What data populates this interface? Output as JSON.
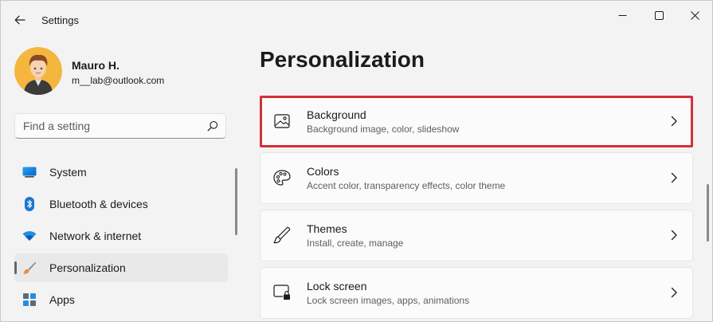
{
  "window": {
    "title": "Settings"
  },
  "profile": {
    "name": "Mauro H.",
    "email": "m__lab@outlook.com"
  },
  "search": {
    "placeholder": "Find a setting"
  },
  "sidebar": {
    "items": [
      {
        "label": "System",
        "icon": "system-icon",
        "selected": false
      },
      {
        "label": "Bluetooth & devices",
        "icon": "bluetooth-icon",
        "selected": false
      },
      {
        "label": "Network & internet",
        "icon": "wifi-icon",
        "selected": false
      },
      {
        "label": "Personalization",
        "icon": "brush-icon",
        "selected": true
      },
      {
        "label": "Apps",
        "icon": "apps-icon",
        "selected": false
      }
    ]
  },
  "main": {
    "title": "Personalization",
    "cards": [
      {
        "title": "Background",
        "subtitle": "Background image, color, slideshow",
        "icon": "image-icon",
        "highlighted": true
      },
      {
        "title": "Colors",
        "subtitle": "Accent color, transparency effects, color theme",
        "icon": "palette-icon",
        "highlighted": false
      },
      {
        "title": "Themes",
        "subtitle": "Install, create, manage",
        "icon": "pen-icon",
        "highlighted": false
      },
      {
        "title": "Lock screen",
        "subtitle": "Lock screen images, apps, animations",
        "icon": "lock-screen-icon",
        "highlighted": false
      }
    ]
  },
  "colors": {
    "highlight": "#d32f3a",
    "window_bg": "#f3f3f3",
    "card_bg": "#fbfbfb"
  }
}
